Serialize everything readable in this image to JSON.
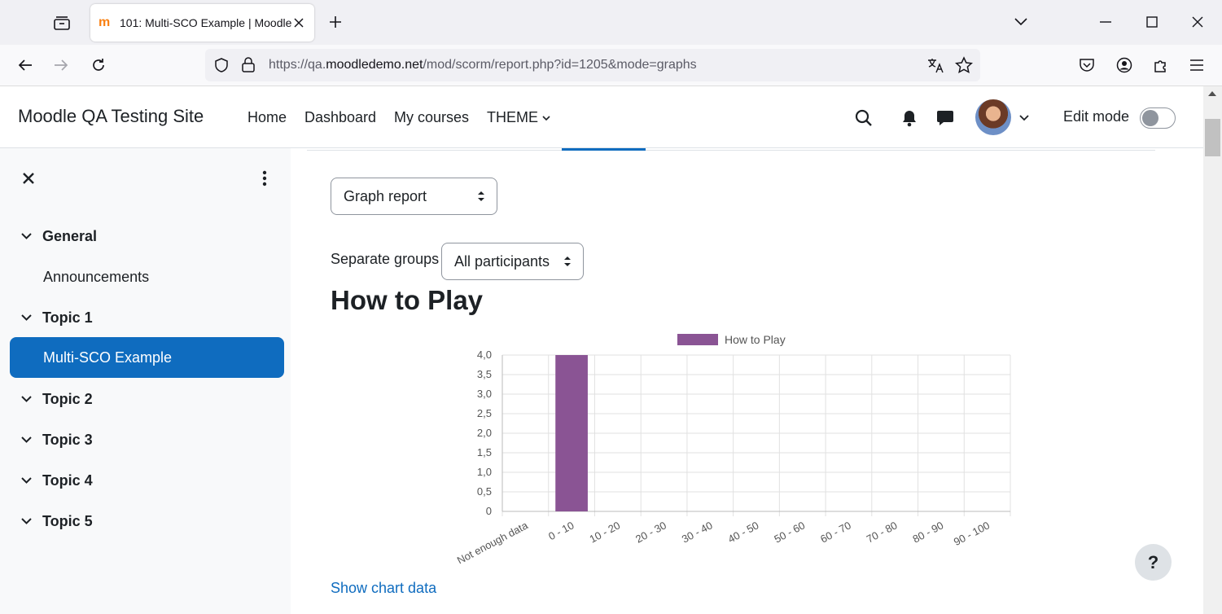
{
  "browser": {
    "tab_title": "101: Multi-SCO Example | Moodle",
    "url_prefix": "https://qa.",
    "url_domain": "moodledemo.net",
    "url_path": "/mod/scorm/report.php?id=1205&mode=graphs"
  },
  "site": {
    "brand": "Moodle QA Testing Site",
    "nav": [
      "Home",
      "Dashboard",
      "My courses",
      "THEME"
    ],
    "edit_mode_label": "Edit mode"
  },
  "drawer": {
    "items": [
      {
        "label": "General",
        "type": "section"
      },
      {
        "label": "Announcements",
        "type": "child"
      },
      {
        "label": "Topic 1",
        "type": "section"
      },
      {
        "label": "Multi-SCO Example",
        "type": "child",
        "active": true
      },
      {
        "label": "Topic 2",
        "type": "section"
      },
      {
        "label": "Topic 3",
        "type": "section"
      },
      {
        "label": "Topic 4",
        "type": "section"
      },
      {
        "label": "Topic 5",
        "type": "section"
      }
    ]
  },
  "main": {
    "report_select": "Graph report",
    "groups_label": "Separate groups",
    "groups_select": "All participants",
    "heading": "How to Play",
    "show_chart_data": "Show chart data",
    "help_label": "?"
  },
  "chart_data": {
    "type": "bar",
    "categories": [
      "Not enough data",
      "0 - 10",
      "10 - 20",
      "20 - 30",
      "30 - 40",
      "40 - 50",
      "50 - 60",
      "60 - 70",
      "70 - 80",
      "80 - 90",
      "90 - 100"
    ],
    "series": [
      {
        "name": "How to Play",
        "values": [
          0,
          4,
          0,
          0,
          0,
          0,
          0,
          0,
          0,
          0,
          0
        ],
        "color": "#8a5494"
      }
    ],
    "yticks": [
      "0",
      "0,5",
      "1,0",
      "1,5",
      "2,0",
      "2,5",
      "3,0",
      "3,5",
      "4,0"
    ],
    "ylim": [
      0,
      4
    ],
    "grid": true,
    "legend": "top"
  },
  "colors": {
    "primary": "#0f6cbf",
    "bar": "#8a5494"
  }
}
